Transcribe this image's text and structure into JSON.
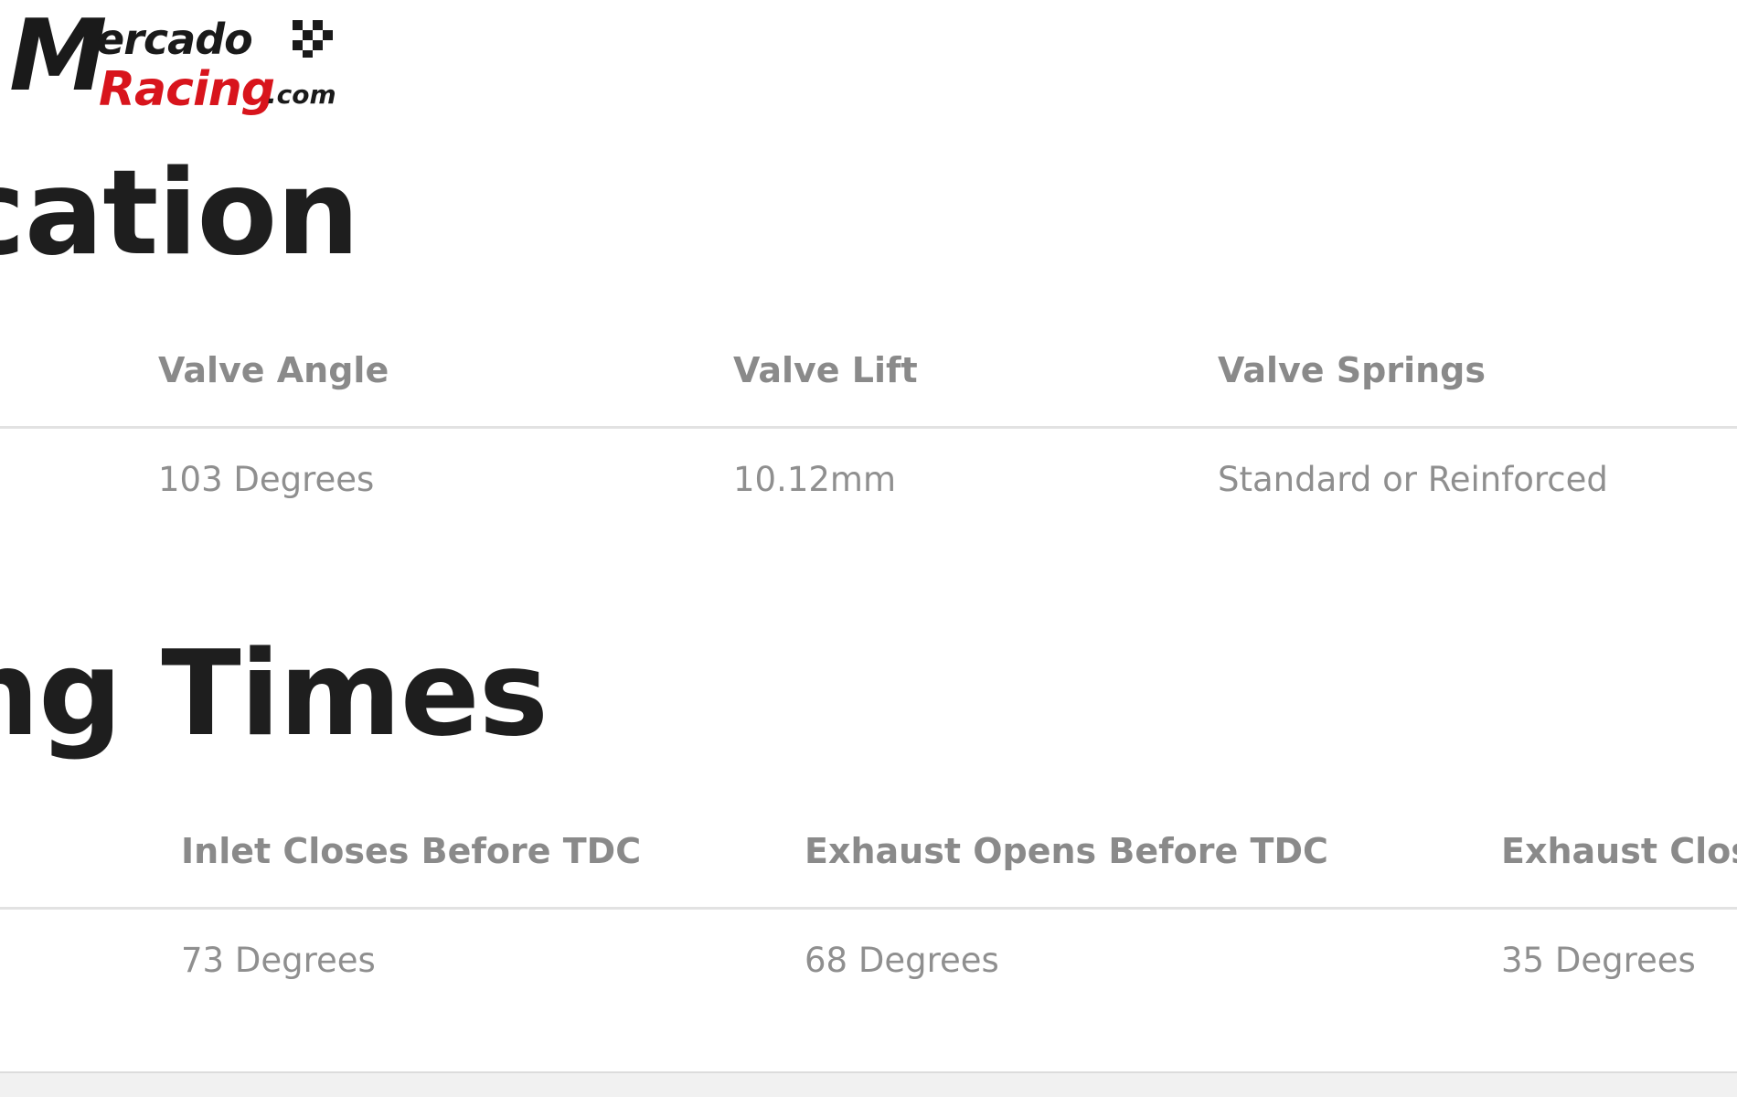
{
  "logo": {
    "initial": "M",
    "top_text": "ercado",
    "bottom_text": "Racing",
    "domain": ".com",
    "flag_icon": "checkered-flag-icon",
    "brand_color": "#d8141c"
  },
  "sections": [
    {
      "heading": "cation",
      "columns": [
        {
          "header": "Valve Angle",
          "value": "103 Degrees"
        },
        {
          "header": "Valve Lift",
          "value": "10.12mm"
        },
        {
          "header": "Valve Springs",
          "value": "Standard or Reinforced"
        }
      ]
    },
    {
      "heading": "ng Times",
      "columns": [
        {
          "header": "Inlet Closes Before TDC",
          "value": "73 Degrees"
        },
        {
          "header": "Exhaust Opens Before TDC",
          "value": "68 Degrees"
        },
        {
          "header": "Exhaust Close",
          "value": "35 Degrees"
        }
      ]
    }
  ]
}
